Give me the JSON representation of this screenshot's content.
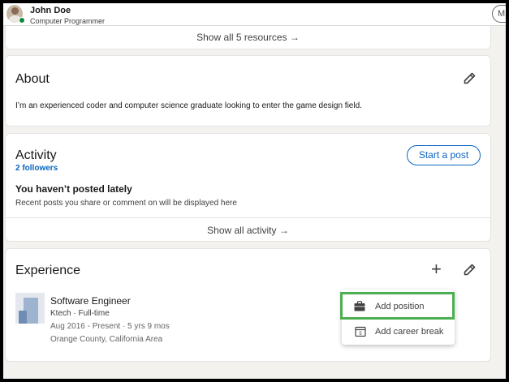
{
  "profile": {
    "name": "John Doe",
    "title": "Computer Programmer",
    "more_label": "M"
  },
  "resources": {
    "show_all": "Show all 5 resources →"
  },
  "about": {
    "heading": "About",
    "text": "I’m an experienced coder and computer science graduate looking to enter the game design field."
  },
  "activity": {
    "heading": "Activity",
    "followers": "2 followers",
    "start_post": "Start a post",
    "empty_title": "You haven’t posted lately",
    "empty_sub": "Recent posts you share or comment on will be displayed here",
    "show_all": "Show all activity →"
  },
  "experience": {
    "heading": "Experience",
    "add_icon": "plus-icon",
    "edit_icon": "pencil-icon",
    "items": [
      {
        "title": "Software Engineer",
        "company": "Ktech · Full-time",
        "dates": "Aug 2016 - Present · 5 yrs 9 mos",
        "location": "Orange County, California Area"
      }
    ],
    "menu": [
      {
        "label": "Add position",
        "icon": "briefcase-icon"
      },
      {
        "label": "Add career break",
        "icon": "calendar-icon"
      }
    ]
  },
  "colors": {
    "accent": "#0a66c2",
    "highlight": "#4caf50",
    "background": "#f3f2ef"
  }
}
